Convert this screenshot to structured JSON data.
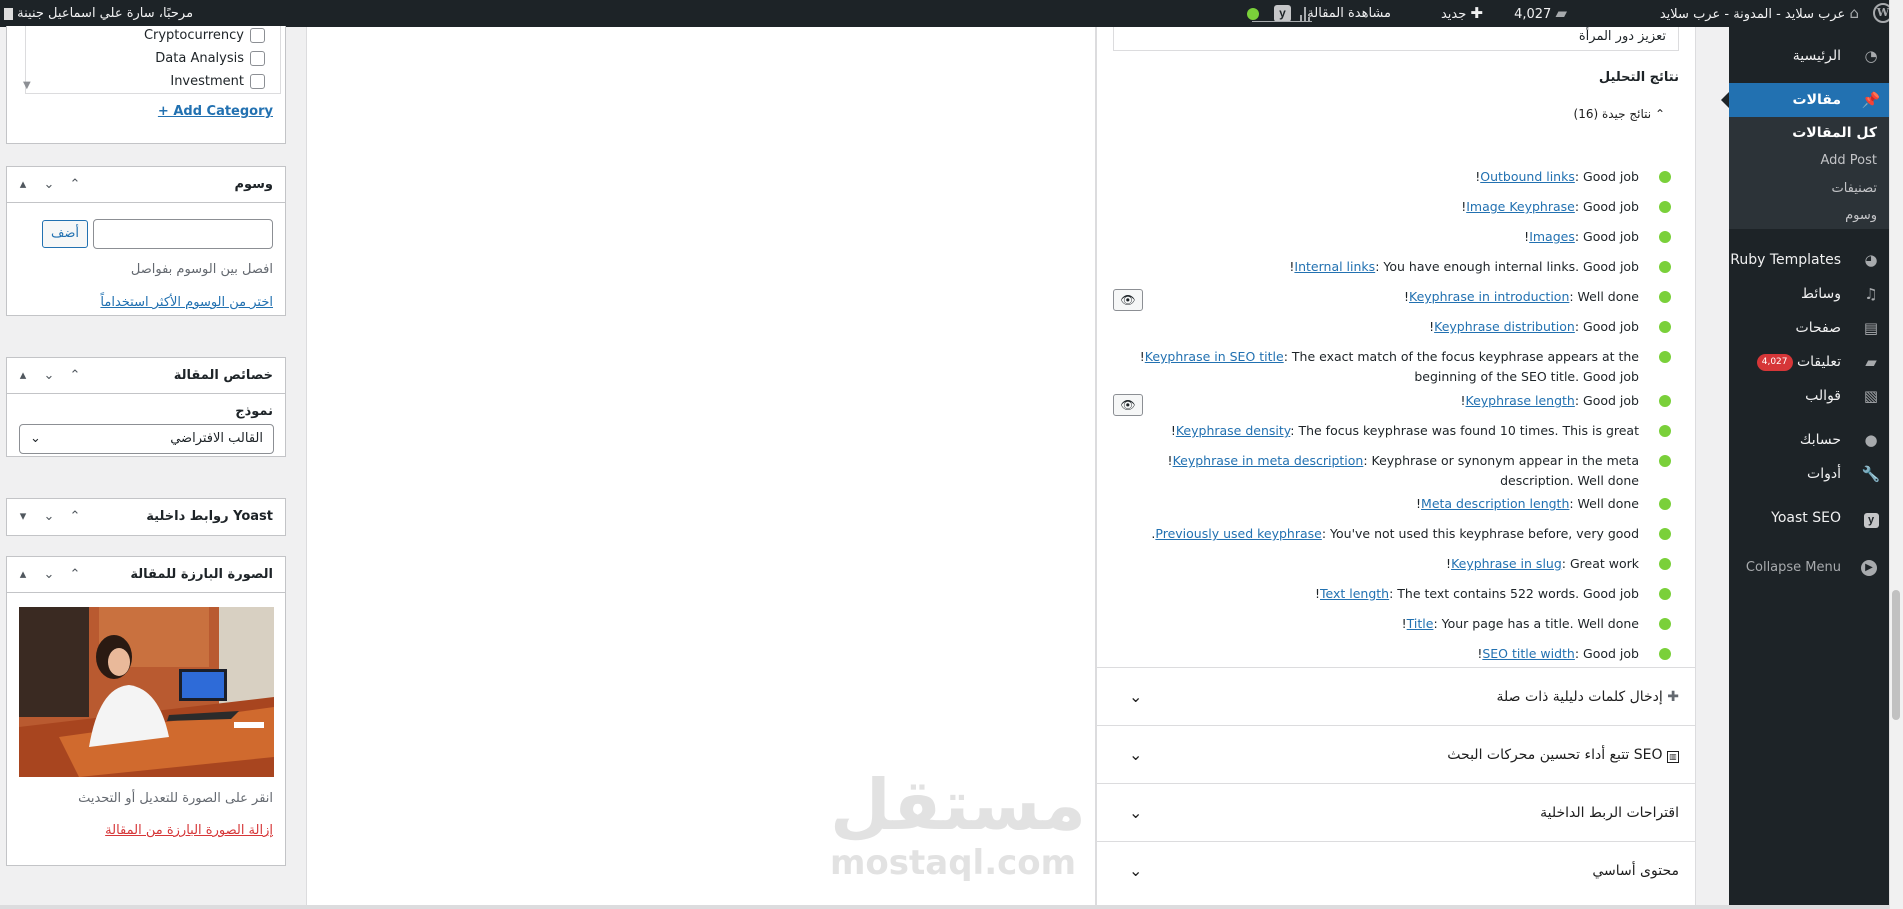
{
  "adminbar": {
    "site_name": "عرب سلايد - المدونة - عرب سلايد",
    "comments_count": "4,027",
    "new_label": "جديد",
    "view_post": "مشاهدة المقالة",
    "greeting": "مرحبًا، سارة علي اسماعيل جنينة"
  },
  "menu": {
    "items": [
      {
        "label": "الرئيسية",
        "icon": "dashboard-icon"
      },
      {
        "label": "مقالات",
        "icon": "pin-icon"
      },
      {
        "label": "Ruby Templates",
        "icon": "ruby-icon"
      },
      {
        "label": "وسائط",
        "icon": "media-icon"
      },
      {
        "label": "صفحات",
        "icon": "pages-icon"
      },
      {
        "label": "تعليقات",
        "icon": "comments-icon",
        "badge": "4,027"
      },
      {
        "label": "قوالب",
        "icon": "appearance-icon"
      },
      {
        "label": "حسابك",
        "icon": "user-icon"
      },
      {
        "label": "أدوات",
        "icon": "tools-icon"
      },
      {
        "label": "Yoast SEO",
        "icon": "yoast-icon"
      }
    ],
    "submenu": [
      "كل المقالات",
      "Add Post",
      "تصنيفات",
      "وسوم"
    ],
    "collapse": "Collapse Menu"
  },
  "categories": {
    "items": [
      "Cryptocurrency",
      "Data Analysis",
      "Investment"
    ],
    "add_link": "+ Add Category"
  },
  "tags": {
    "title": "وسوم",
    "add_button": "أضف",
    "hint": "افصل بين الوسوم بفواصل",
    "choose_link": "اختر من الوسوم الأكثر استخداماً"
  },
  "post_attributes": {
    "title": "خصائص المقالة",
    "template_label": "نموذج",
    "template_value": "القالب الافتراضي"
  },
  "yoast_links": {
    "title": "روابط داخلية Yoast"
  },
  "featured_image": {
    "title": "الصورة البارزة للمقالة",
    "hint": "انقر على الصورة للتعديل أو التحديث",
    "remove_link": "إزالة الصورة البارزة من المقالة"
  },
  "yoast": {
    "focus_value": "تعزيز دور المرأة",
    "analysis_heading": "نتائج التحليل",
    "good_results": "نتائج جيدة (16)",
    "results": [
      {
        "link": "Outbound links",
        "text": ": Good job",
        "tail": "!"
      },
      {
        "link": "Image Keyphrase",
        "text": ": Good job",
        "tail": "!"
      },
      {
        "link": "Images",
        "text": ": Good job",
        "tail": "!"
      },
      {
        "link": "Internal links",
        "text": ": You have enough internal links. Good job",
        "tail": "!"
      },
      {
        "link": "Keyphrase in introduction",
        "text": ": Well done",
        "tail": "!"
      },
      {
        "link": "Keyphrase distribution",
        "text": ": Good job",
        "tail": "!"
      },
      {
        "link": "Keyphrase in SEO title",
        "text": ": The exact match of the focus keyphrase appears at the beginning of the SEO title. Good job",
        "tail": "!"
      },
      {
        "link": "Keyphrase length",
        "text": ": Good job",
        "tail": "!"
      },
      {
        "link": "Keyphrase density",
        "text": ": The focus keyphrase was found 10 times. This is great",
        "tail": "!"
      },
      {
        "link": "Keyphrase in meta description",
        "text": ": Keyphrase or synonym appear in the meta description. Well done",
        "tail": "!"
      },
      {
        "link": "Meta description length",
        "text": ": Well done",
        "tail": "!"
      },
      {
        "link": "Previously used keyphrase",
        "text": ": You've not used this keyphrase before, very good",
        "tail": "."
      },
      {
        "link": "Keyphrase in slug",
        "text": ": Great work",
        "tail": "!"
      },
      {
        "link": "Text length",
        "text": ": The text contains 522 words. Good job",
        "tail": "!"
      },
      {
        "link": "Title",
        "text": ": Your page has a title. Well done",
        "tail": "!"
      },
      {
        "link": "SEO title width",
        "text": ": Good job",
        "tail": "!"
      }
    ],
    "sections": [
      "إدخال كلمات دليلية ذات صلة",
      "تتبع أداء تحسين محركات البحث SEO",
      "اقتراحات الربط الداخلية",
      "محتوى أساسي"
    ]
  },
  "watermark": {
    "ar": "مستقل",
    "en": "mostaql.com"
  }
}
